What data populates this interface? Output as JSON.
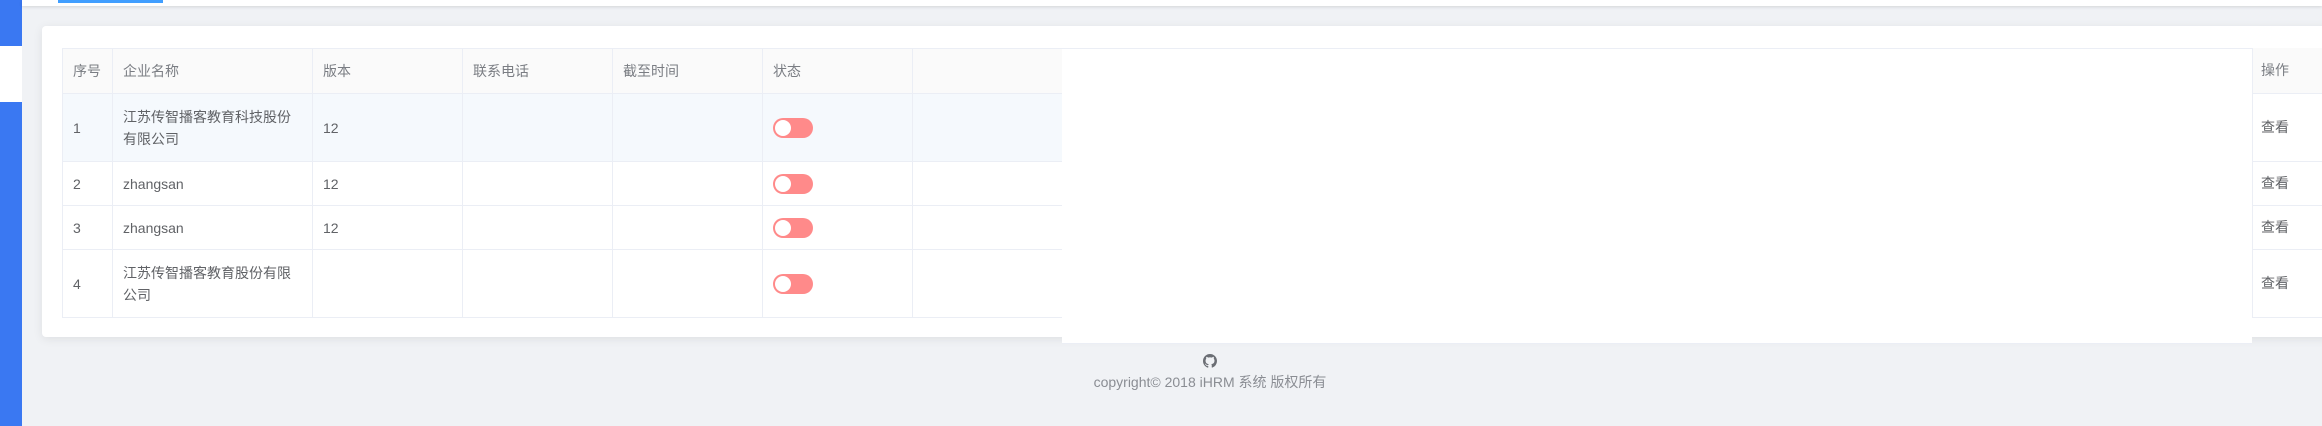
{
  "table": {
    "headers": [
      "序号",
      "企业名称",
      "版本",
      "联系电话",
      "截至时间",
      "状态",
      ""
    ],
    "action_header": "操作",
    "rows": [
      {
        "index": "1",
        "company": "江苏传智播客教育科技股份有限公司",
        "version": "12",
        "phone": "",
        "deadline": "",
        "status_on": false,
        "action": "查看"
      },
      {
        "index": "2",
        "company": "zhangsan",
        "version": "12",
        "phone": "",
        "deadline": "",
        "status_on": false,
        "action": "查看"
      },
      {
        "index": "3",
        "company": "zhangsan",
        "version": "12",
        "phone": "",
        "deadline": "",
        "status_on": false,
        "action": "查看"
      },
      {
        "index": "4",
        "company": "江苏传智播客教育股份有限公司",
        "version": "",
        "phone": "",
        "deadline": "",
        "status_on": false,
        "action": "查看"
      }
    ]
  },
  "footer": {
    "icon": "github-icon",
    "text": "copyright© 2018 iHRM 系统 版权所有"
  },
  "colors": {
    "sidebar": "#3a78f2",
    "accent": "#409eff",
    "switch_off": "#ff8a8a",
    "page_bg": "#f0f2f5"
  }
}
